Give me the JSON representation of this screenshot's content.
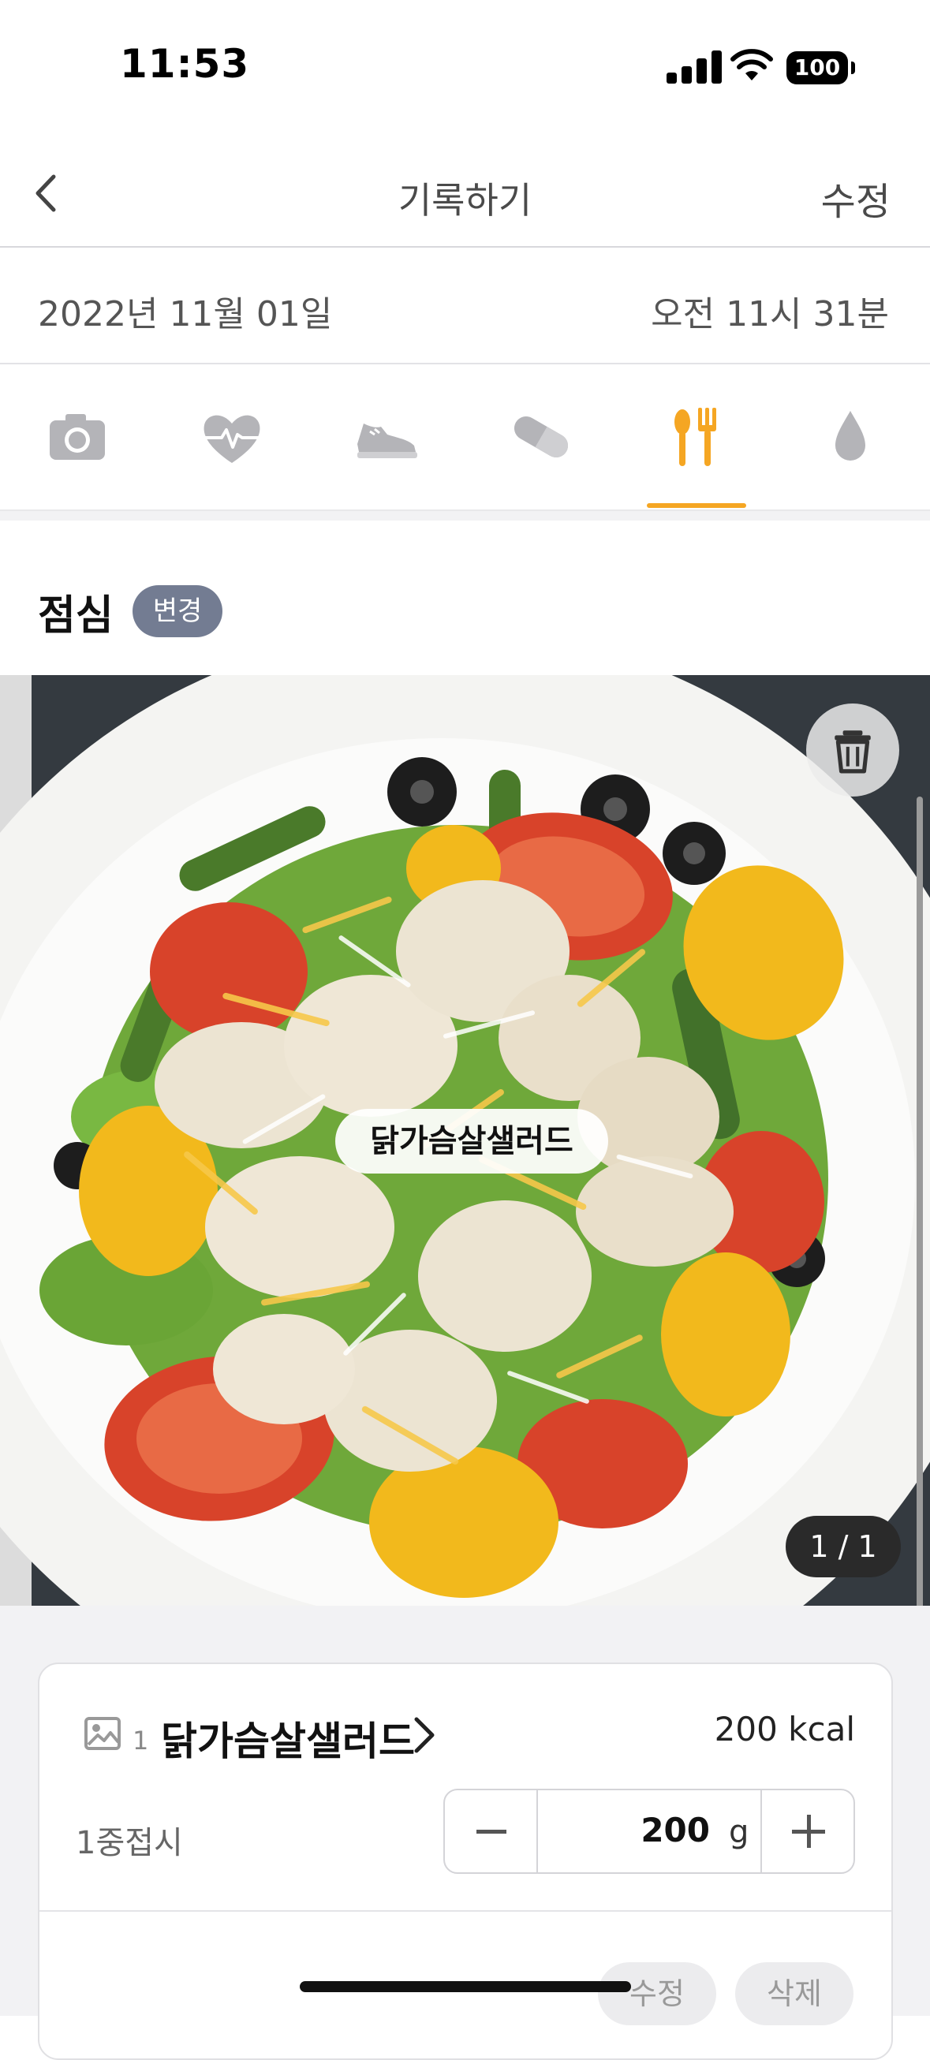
{
  "status_bar": {
    "time": "11:53",
    "battery": "100"
  },
  "nav": {
    "title": "기록하기",
    "edit_label": "수정",
    "back_icon": "chevron-left-icon"
  },
  "record": {
    "date": "2022년 11월 01일",
    "time": "오전 11시 31분"
  },
  "tabs": [
    {
      "icon": "camera-icon",
      "active": false
    },
    {
      "icon": "heart-pulse-icon",
      "active": false
    },
    {
      "icon": "sneaker-icon",
      "active": false
    },
    {
      "icon": "pill-icon",
      "active": false
    },
    {
      "icon": "fork-spoon-icon",
      "active": true
    },
    {
      "icon": "water-drop-icon",
      "active": false
    }
  ],
  "meal": {
    "title": "점심",
    "change_label": "변경"
  },
  "photo": {
    "food_tag": "닭가슴살샐러드",
    "counter": "1 / 1"
  },
  "food_item": {
    "index": "1",
    "name": "닭가슴살샐러드",
    "kcal": "200 kcal",
    "serving": "1중접시",
    "amount": "200",
    "unit": "g",
    "edit_label": "수정",
    "delete_label": "삭제"
  },
  "colors": {
    "accent": "#f5a623",
    "badge": "#737c92",
    "inactive_icon": "#b4b4b8"
  }
}
